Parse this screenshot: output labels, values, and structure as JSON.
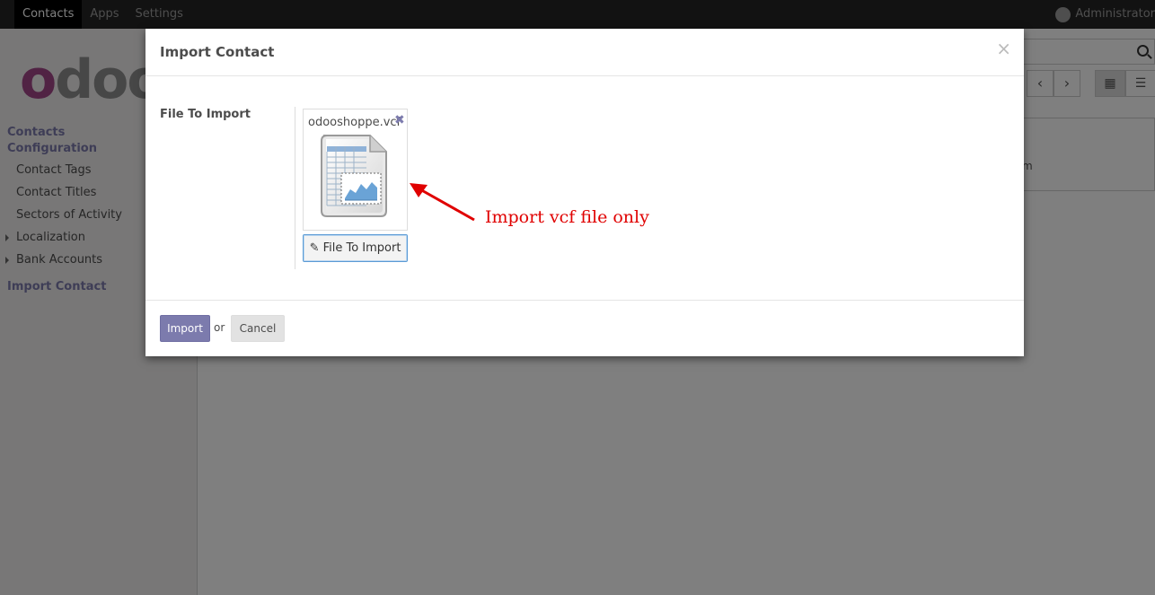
{
  "topbar": {
    "menu": [
      "Contacts",
      "Apps",
      "Settings"
    ],
    "user": "Administrator"
  },
  "sidebar": {
    "section1": "Contacts Configuration",
    "items": [
      "Contact Tags",
      "Contact Titles",
      "Sectors of Activity",
      "Localization",
      "Bank Accounts"
    ],
    "section2": "Import Contact"
  },
  "background": {
    "logo_text": "odoo",
    "card_text": "m"
  },
  "modal": {
    "title": "Import Contact",
    "close": "×",
    "field_label": "File To Import",
    "file_name": "odooshoppe.vcf",
    "remove": "✖",
    "upload_button": "✎ File To Import",
    "annotation": "Import vcf file only",
    "import_button": "Import",
    "or": "or",
    "cancel_button": "Cancel"
  },
  "colors": {
    "accent": "#7c7bad",
    "annotation": "#e00000"
  }
}
